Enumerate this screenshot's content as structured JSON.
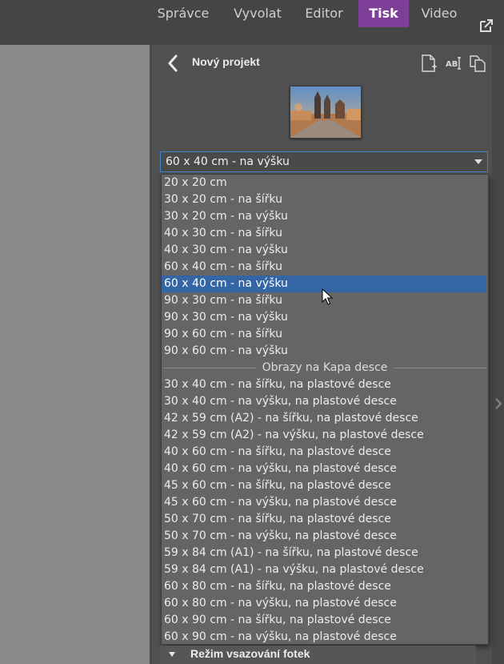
{
  "nav": {
    "tabs": [
      {
        "label": "Správce",
        "active": false
      },
      {
        "label": "Vyvolat",
        "active": false
      },
      {
        "label": "Editor",
        "active": false
      },
      {
        "label": "Tisk",
        "active": true
      },
      {
        "label": "Video",
        "active": false
      }
    ],
    "accent_color": "#7d3f98"
  },
  "panel": {
    "title": "Nový projekt",
    "toolbar_icons": [
      "new-page-icon",
      "text-edit-icon",
      "duplicate-icon"
    ],
    "size_select": {
      "value": "60 x 40 cm - na výšku"
    },
    "dropdown": {
      "options": [
        "20 x 20 cm",
        "30 x 20 cm - na šířku",
        "30 x 20 cm - na výšku",
        "40 x 30 cm - na šířku",
        "40 x 30 cm - na výšku",
        "60 x 40 cm - na šířku",
        "60 x 40 cm - na výšku",
        "90 x 30 cm - na šířku",
        "90 x 30 cm - na výšku",
        "90 x 60 cm - na šířku",
        "90 x 60 cm - na výšku"
      ],
      "selected_index": 6,
      "group_label": "Obrazy na Kapa desce",
      "group_options": [
        "30 x 40 cm - na šířku, na plastové desce",
        "30 x 40 cm - na výšku, na plastové desce",
        "42 x 59 cm (A2) - na šířku, na plastové desce",
        "42 x 59 cm (A2) - na výšku, na plastové desce",
        "40 x 60 cm - na šířku, na plastové desce",
        "40 x 60 cm - na výšku, na plastové desce",
        "45 x 60 cm - na šířku, na plastové desce",
        "45 x 60 cm - na výšku, na plastové desce",
        "50 x 70 cm - na šířku, na plastové desce",
        "50 x 70 cm - na výšku, na plastové desce",
        "59 x 84 cm (A1) - na šířku, na plastové desce",
        "59 x 84 cm (A1) - na výšku, na plastové desce",
        "60 x 80 cm - na šířku, na plastové desce",
        "60 x 80 cm - na výšku, na plastové desce",
        "60 x 90 cm - na šířku, na plastové desce",
        "60 x 90 cm - na výšku, na plastové desce"
      ],
      "selected_color": "#3465a4"
    },
    "bottom_section": {
      "label": "Režim vsazování fotek"
    }
  }
}
